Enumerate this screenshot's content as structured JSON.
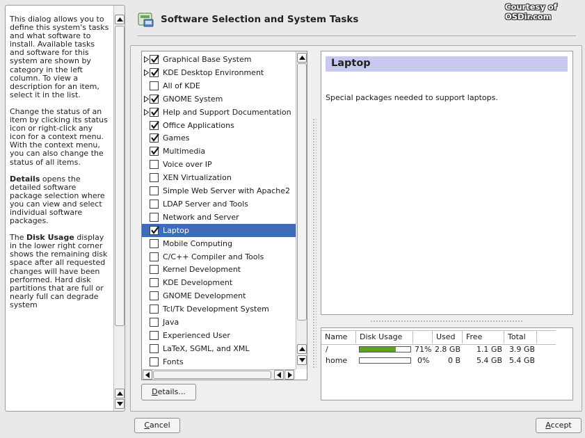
{
  "window": {
    "title": "Software Selection and System Tasks",
    "watermark": "Courtesy of OSDir.com"
  },
  "help": {
    "p1": "This dialog allows you to define this system's tasks and what software to install. Available tasks and software for this system are shown by category in the left column. To view a description for an item, select it in the list.",
    "p2": "Change the status of an item by clicking its status icon or right-click any icon for a context menu. With the context menu, you can also change the status of all items.",
    "p3_bold": "Details",
    "p3_rest": " opens the detailed software package selection where you can view and select individual software packages.",
    "p4_pre": "The ",
    "p4_bold": "Disk Usage",
    "p4_rest": " display in the lower right corner shows the remaining disk space after all requested changes will have been performed. Hard disk partitions that are full or nearly full can degrade system"
  },
  "packages": [
    {
      "label": "Graphical Base System",
      "checked": true,
      "expander": true
    },
    {
      "label": "KDE Desktop Environment",
      "checked": true,
      "expander": true
    },
    {
      "label": "All of KDE",
      "checked": false,
      "expander": false
    },
    {
      "label": "GNOME System",
      "checked": true,
      "expander": true
    },
    {
      "label": "Help and Support Documentation",
      "checked": true,
      "expander": true
    },
    {
      "label": "Office Applications",
      "checked": true,
      "expander": false
    },
    {
      "label": "Games",
      "checked": true,
      "expander": false
    },
    {
      "label": "Multimedia",
      "checked": true,
      "expander": false
    },
    {
      "label": "Voice over IP",
      "checked": false,
      "expander": false
    },
    {
      "label": "XEN Virtualization",
      "checked": false,
      "expander": false
    },
    {
      "label": "Simple Web Server with Apache2",
      "checked": false,
      "expander": false
    },
    {
      "label": "LDAP Server and Tools",
      "checked": false,
      "expander": false
    },
    {
      "label": "Network and Server",
      "checked": false,
      "expander": false
    },
    {
      "label": "Laptop",
      "checked": true,
      "expander": false,
      "selected": true
    },
    {
      "label": "Mobile Computing",
      "checked": false,
      "expander": false
    },
    {
      "label": "C/C++ Compiler and Tools",
      "checked": false,
      "expander": false
    },
    {
      "label": "Kernel Development",
      "checked": false,
      "expander": false
    },
    {
      "label": "KDE Development",
      "checked": false,
      "expander": false
    },
    {
      "label": "GNOME Development",
      "checked": false,
      "expander": false
    },
    {
      "label": "Tcl/Tk Development System",
      "checked": false,
      "expander": false
    },
    {
      "label": "Java",
      "checked": false,
      "expander": false
    },
    {
      "label": "Experienced User",
      "checked": false,
      "expander": false
    },
    {
      "label": "LaTeX, SGML, and XML",
      "checked": false,
      "expander": false
    },
    {
      "label": "Fonts",
      "checked": false,
      "expander": false
    }
  ],
  "description": {
    "title": "Laptop",
    "text": "Special packages needed to support laptops."
  },
  "disk_usage": {
    "headers": [
      "Name",
      "Disk Usage",
      "",
      "Used",
      "Free",
      "Total"
    ],
    "rows": [
      {
        "name": "/",
        "percent": 71,
        "percent_label": "71%",
        "used": "2.8 GB",
        "free": "1.1 GB",
        "total": "3.9 GB"
      },
      {
        "name": "home",
        "percent": 0,
        "percent_label": "0%",
        "used": "0 B",
        "free": "5.4 GB",
        "total": "5.4 GB"
      }
    ],
    "bar_color": "#5aa61d"
  },
  "buttons": {
    "details": "Details...",
    "details_mnemonic": "D",
    "cancel": "Cancel",
    "cancel_mnemonic": "C",
    "accept": "Accept",
    "accept_mnemonic": "A"
  },
  "colors": {
    "selection": "#3f6cb7",
    "title_bar": "#c9c9ef"
  }
}
